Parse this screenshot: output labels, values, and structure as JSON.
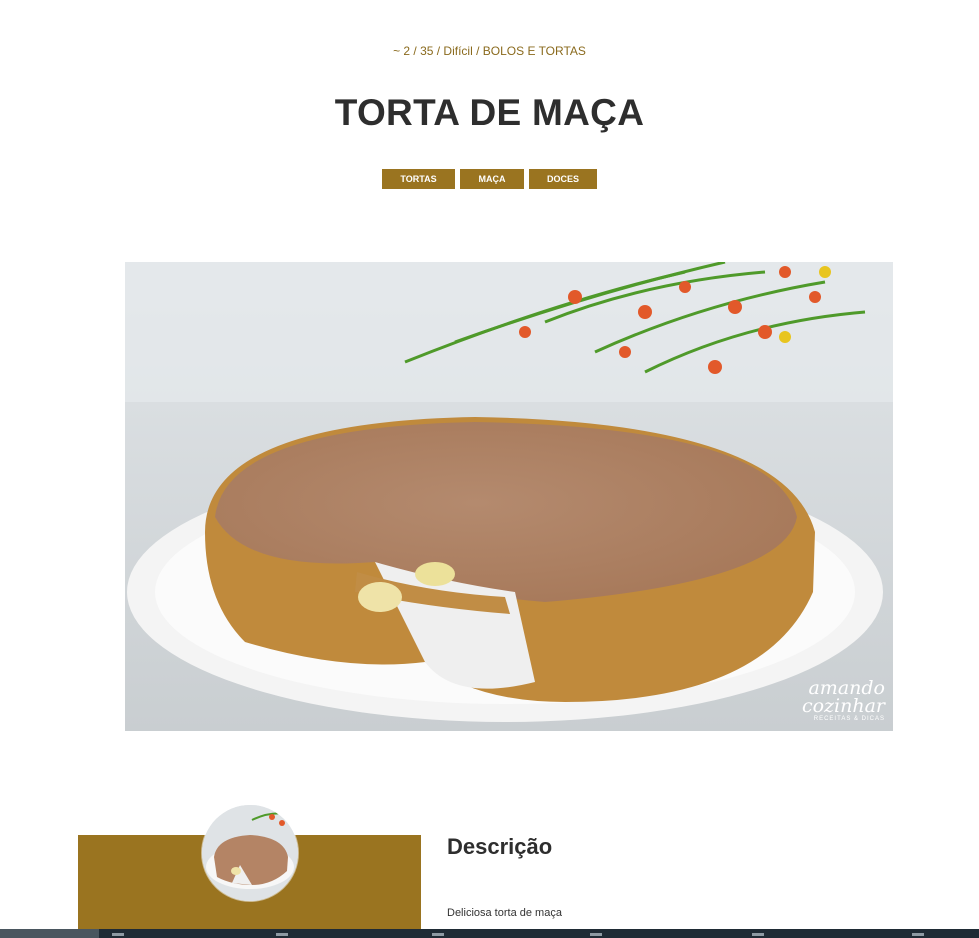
{
  "recipe": {
    "meta": "~ 2 / 35 / Difícil / BOLOS E TORTAS",
    "title": "TORTA DE MAÇA",
    "tags": [
      "TORTAS",
      "MAÇA",
      "DOCES"
    ]
  },
  "hero_image": {
    "alt": "torta de maçã",
    "watermark_line1": "amando",
    "watermark_line2": "cozinhar",
    "watermark_sub": "RECEITAS & DICAS"
  },
  "description": {
    "heading": "Descrição",
    "text": "Deliciosa torta de maça"
  },
  "colors": {
    "accent": "#9a7420",
    "meta_text": "#8a6a1d",
    "title_text": "#2e2e2e"
  }
}
